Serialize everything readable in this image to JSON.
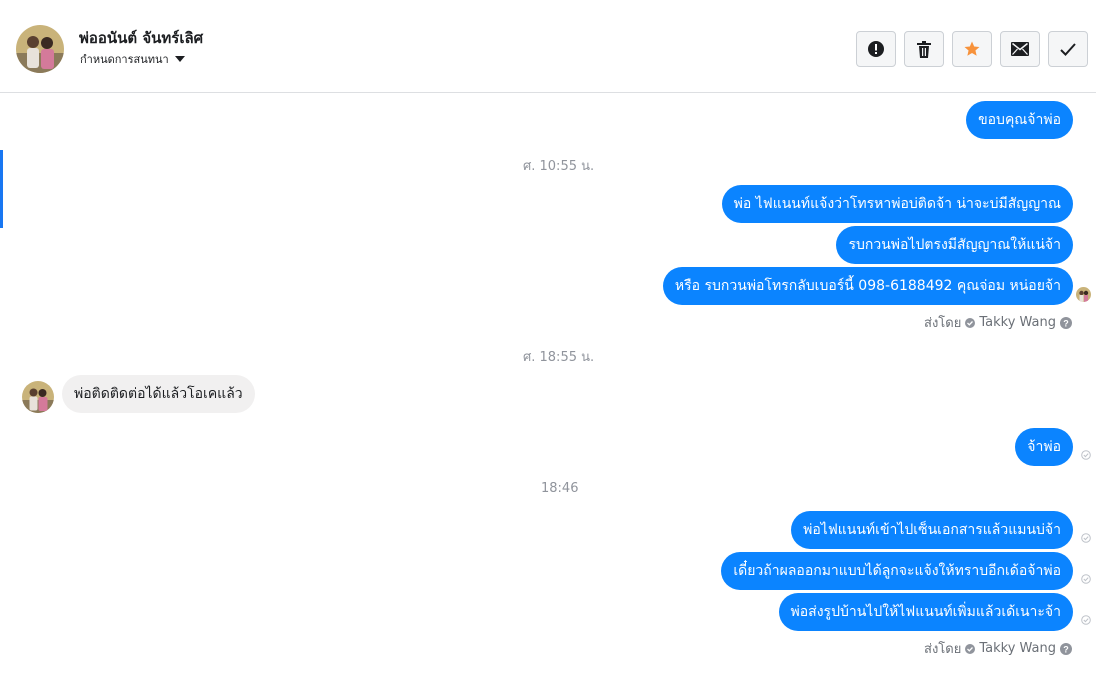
{
  "header": {
    "contact_name": "พ่ออนันต์ จันทร์เลิศ",
    "settings_label": "กำหนดการสนทนา",
    "actions": [
      "mark-spam",
      "delete",
      "star",
      "mark-unread",
      "mark-done"
    ]
  },
  "colors": {
    "outgoing_bubble": "#0b84ff",
    "incoming_bubble": "#f1f0f0",
    "accent_star": "#f7923b",
    "timestamp": "#90949c"
  },
  "conversation": {
    "msg_1": "ขอบคุณจ้าพ่อ",
    "time_1": "ศ. 10:55 น.",
    "msg_2": "พ่อ ไฟแนนท์แจ้งว่าโทรหาพ่อบ่ติดจ้า น่าจะบ่มีสัญญาณ",
    "msg_3": "รบกวนพ่อไปตรงมีสัญญาณให้แน่จ้า",
    "msg_4": "หรือ รบกวนพ่อโทรกลับเบอร์นี้ 098-6188492 คุณจ่อม หน่อยจ้า",
    "sent_by_prefix_1": "ส่งโดย",
    "sent_by_name_1": "Takky Wang",
    "time_2": "ศ. 18:55 น.",
    "msg_5": "พ่อติดติดต่อได้แล้วโอเคแล้ว",
    "msg_6": "จ้าพ่อ",
    "time_3": "18:46",
    "msg_7": "พ่อไฟแนนท์เข้าไปเซ็นเอกสารแล้วแมนบ่จ้า",
    "msg_8": "เดี๋ยวถ้าผลออกมาแบบได้ลูกจะแจ้งให้ทราบอีกเด้อจ้าพ่อ",
    "msg_9": "พ่อส่งรูปบ้านไปให้ไฟแนนท์เพิ่มแล้วเด้เนาะจ้า",
    "sent_by_prefix_2": "ส่งโดย",
    "sent_by_name_2": "Takky Wang"
  }
}
